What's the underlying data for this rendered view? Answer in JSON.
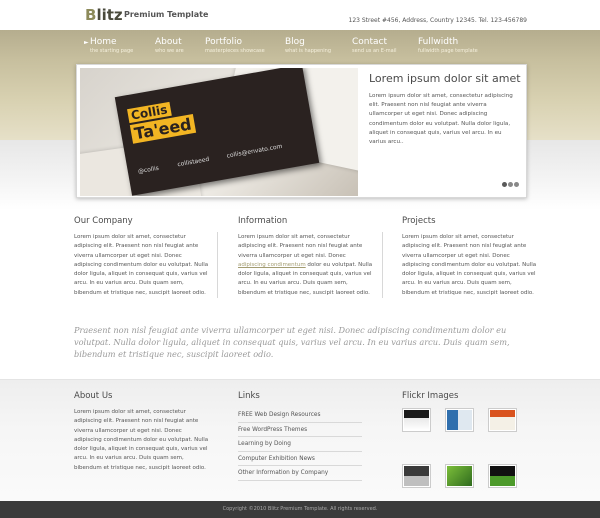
{
  "header": {
    "logo_first": "B",
    "logo_rest": "litz",
    "tagline": "Premium Template",
    "address": "123 Street #456, Address, Country 12345. Tel. 123-456789"
  },
  "nav": [
    {
      "label": "Home",
      "sub": "the starting page"
    },
    {
      "label": "About",
      "sub": "who we are"
    },
    {
      "label": "Portfolio",
      "sub": "masterpieces showcase"
    },
    {
      "label": "Blog",
      "sub": "what is happening"
    },
    {
      "label": "Contact",
      "sub": "send us an E-mail"
    },
    {
      "label": "Fullwidth",
      "sub": "fullwidth page template"
    }
  ],
  "nav_arrow": "►",
  "slider": {
    "image_card": {
      "line1": "Collis",
      "line2": "Ta'eed",
      "handle": "@collis",
      "name": "collistaeed",
      "email": "collis@envato.com"
    },
    "title": "Lorem ipsum dolor sit amet",
    "text": "Lorem ipsum dolor sit amet, consectetur adipiscing elit. Praesent non nisl feugiat ante viverra ullamcorper ut eget nisi. Donec adipiscing condimentum dolor eu volutpat. Nulla dolor ligula, aliquet in consequat quis, varius vel arcu. In eu varius arcu.."
  },
  "columns": [
    {
      "title": "Our Company",
      "text": "Lorem ipsum dolor sit amet, consectetur adipiscing elit. Praesent non nisl feugiat ante viverra ullamcorper ut eget nisi. Donec adipiscing condimentum dolor eu volutpat. Nulla dolor ligula, aliquet in consequat quis, varius vel arcu. In eu varius arcu. Duis quam sem, bibendum et tristique nec, suscipit laoreet odio."
    },
    {
      "title": "Information",
      "text_before": "Lorem ipsum dolor sit amet, consectetur adipiscing elit. Praesent non nisl feugiat ante viverra ullamcorper ut eget nisi. Donec ",
      "link": "adipiscing condimentum",
      "text_after": " dolor eu volutpat. Nulla dolor ligula, aliquet in consequat quis, varius vel arcu. In eu varius arcu. Duis quam sem, bibendum et tristique nec, suscipit laoreet odio."
    },
    {
      "title": "Projects",
      "text": "Lorem ipsum dolor sit amet, consectetur adipiscing elit. Praesent non nisl feugiat ante viverra ullamcorper ut eget nisi. Donec adipiscing condimentum dolor eu volutpat. Nulla dolor ligula, aliquet in consequat quis, varius vel arcu. In eu varius arcu. Duis quam sem, bibendum et tristique nec, suscipit laoreet odio."
    }
  ],
  "quote": "Praesent non nisl feugiat ante viverra ullamcorper ut eget nisi. Donec adipiscing condimentum dolor eu volutpat. Nulla dolor ligula, aliquet in consequat quis, varius vel arcu. In eu varius arcu. Duis quam sem, bibendum et tristique nec, suscipit laoreet odio.",
  "about": {
    "title": "About Us",
    "text": "Lorem ipsum dolor sit amet, consectetur adipiscing elit. Praesent non nisl feugiat ante viverra ullamcorper ut eget nisi. Donec adipiscing condimentum dolor eu volutpat. Nulla dolor ligula, aliquet in consequat quis, varius vel arcu. In eu varius arcu. Duis quam sem, bibendum et tristique nec, suscipit laoreet odio."
  },
  "links": {
    "title": "Links",
    "items": [
      "FREE Web Design Resources",
      "Free WordPress Themes",
      "Learning by Doing",
      "Computer Exhibition News",
      "Other Information by Company"
    ]
  },
  "flickr": {
    "title": "Flickr Images"
  },
  "footer": {
    "copyright": "Copyright ©2010 Blitz Premium Template. All rights reserved."
  }
}
